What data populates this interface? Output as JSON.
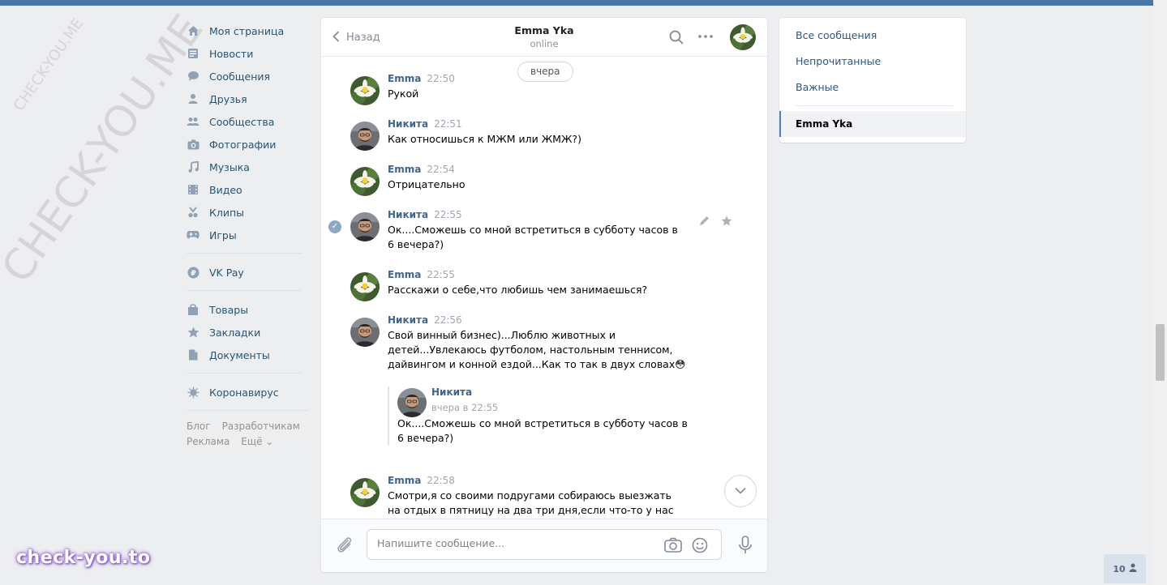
{
  "watermark": {
    "small": "CHECK-YOU.ME",
    "large": "CHECK-YOU.ME"
  },
  "brand": "check-you.to",
  "nav": {
    "items": [
      {
        "label": "Моя страница",
        "icon": "home-icon"
      },
      {
        "label": "Новости",
        "icon": "news-icon"
      },
      {
        "label": "Сообщения",
        "icon": "messages-icon"
      },
      {
        "label": "Друзья",
        "icon": "friends-icon"
      },
      {
        "label": "Сообщества",
        "icon": "communities-icon"
      },
      {
        "label": "Фотографии",
        "icon": "camera-icon"
      },
      {
        "label": "Музыка",
        "icon": "music-icon"
      },
      {
        "label": "Видео",
        "icon": "video-icon"
      },
      {
        "label": "Клипы",
        "icon": "clips-icon"
      },
      {
        "label": "Игры",
        "icon": "games-icon"
      }
    ],
    "vkpay": "VK Pay",
    "items2": [
      {
        "label": "Товары",
        "icon": "bag-icon"
      },
      {
        "label": "Закладки",
        "icon": "star-icon"
      },
      {
        "label": "Документы",
        "icon": "document-icon"
      }
    ],
    "corona": "Коронавирус",
    "footer": {
      "blog": "Блог",
      "dev": "Разработчикам",
      "ads": "Реклама",
      "more": "Ещё ⌄"
    }
  },
  "chat": {
    "back": "Назад",
    "peer_name": "Emma Yka",
    "peer_status": "online",
    "date_pill": "вчера",
    "messages": [
      {
        "author": "Emma",
        "time": "22:50",
        "text": "Рукой"
      },
      {
        "author": "Никита",
        "time": "22:51",
        "text": "Как относишься к МЖМ или ЖМЖ?)"
      },
      {
        "author": "Emma",
        "time": "22:54",
        "text": "Отрицательно"
      },
      {
        "author": "Никита",
        "time": "22:55",
        "text": "Ок....Сможешь со мной встретиться в субботу часов в 6 вечера?)"
      },
      {
        "author": "Emma",
        "time": "22:55",
        "text": "Расскажи о себе,что любишь чем занимаешься?"
      },
      {
        "author": "Никита",
        "time": "22:56",
        "text": "Свой винный бизнес)...Люблю животных и детей...Увлекаюсь футболом, настольным теннисом, дайвингом и конной ездой...Как то так в двух словах😳"
      },
      {
        "author": "Emma",
        "time": "22:58",
        "text": "Смотри,я со своими подругами собираюсь выезжать на отдых в пятницу на два три дня,если что-то у нас не"
      }
    ],
    "forwarded": {
      "author": "Никита",
      "time": "вчера в 22:55",
      "text": "Ок....Сможешь со мной встретиться в субботу часов в 6 вечера?)"
    },
    "input_placeholder": "Напишите сообщение..."
  },
  "right_panel": {
    "all": "Все сообщения",
    "unread": "Непрочитанные",
    "important": "Важные",
    "active_chat": "Emma Yka"
  },
  "counter": "10",
  "colors": {
    "accent": "#4a76a8",
    "link": "#2a5885",
    "author": "#42648b"
  }
}
